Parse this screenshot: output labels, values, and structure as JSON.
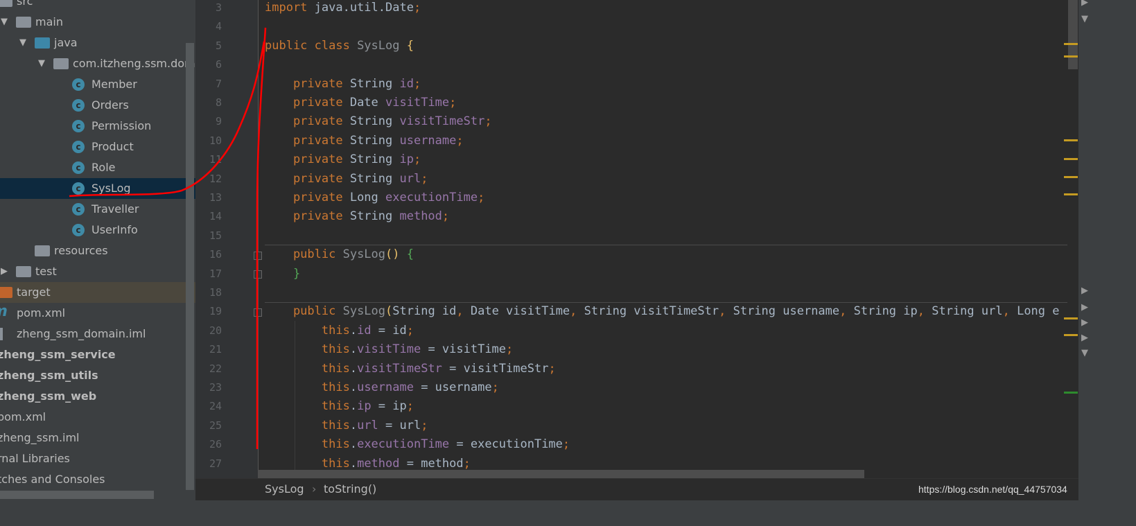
{
  "tree": [
    {
      "label": "src",
      "indent": 0,
      "icon": "folder",
      "color": "#8a9199"
    },
    {
      "label": "main",
      "indent": 1,
      "icon": "folder",
      "arrow": "down",
      "color": "#8a9199"
    },
    {
      "label": "java",
      "indent": 2,
      "icon": "folder",
      "arrow": "down",
      "color": "#3d87a8"
    },
    {
      "label": "com.itzheng.ssm.domain",
      "indent": 3,
      "icon": "package",
      "arrow": "down",
      "color": "#8a9199"
    },
    {
      "label": "Member",
      "indent": 4,
      "icon": "class"
    },
    {
      "label": "Orders",
      "indent": 4,
      "icon": "class"
    },
    {
      "label": "Permission",
      "indent": 4,
      "icon": "class"
    },
    {
      "label": "Product",
      "indent": 4,
      "icon": "class"
    },
    {
      "label": "Role",
      "indent": 4,
      "icon": "class"
    },
    {
      "label": "SysLog",
      "indent": 4,
      "icon": "class",
      "selected": true
    },
    {
      "label": "Traveller",
      "indent": 4,
      "icon": "class"
    },
    {
      "label": "UserInfo",
      "indent": 4,
      "icon": "class"
    },
    {
      "label": "resources",
      "indent": 2,
      "icon": "resources-folder",
      "color": "#8a9199"
    },
    {
      "label": "test",
      "indent": 1,
      "icon": "folder",
      "arrow": "right",
      "color": "#8a9199"
    },
    {
      "label": "target",
      "indent": 0,
      "icon": "folder",
      "color": "#c0642c",
      "highlight": true
    },
    {
      "label": "pom.xml",
      "indent": 0,
      "icon": "maven"
    },
    {
      "label": "zheng_ssm_domain.iml",
      "indent": 0,
      "icon": "iml-file"
    },
    {
      "label": "zheng_ssm_service",
      "indent": -1,
      "bold": true
    },
    {
      "label": "zheng_ssm_utils",
      "indent": -1,
      "bold": true
    },
    {
      "label": "zheng_ssm_web",
      "indent": -1,
      "bold": true
    },
    {
      "label": "pom.xml",
      "indent": -1
    },
    {
      "label": "zheng_ssm.iml",
      "indent": -1
    },
    {
      "label": "rnal Libraries",
      "indent": -1
    },
    {
      "label": "tches and Consoles",
      "indent": -1
    }
  ],
  "code": [
    {
      "n": "3",
      "t": [
        [
          "import ",
          "kw"
        ],
        [
          "java.util.Date",
          "nm"
        ],
        [
          ";",
          "kw"
        ]
      ]
    },
    {
      "n": "4",
      "t": []
    },
    {
      "n": "5",
      "t": [
        [
          "public class ",
          "kw"
        ],
        [
          "SysLog ",
          "gr"
        ],
        [
          "{",
          "br"
        ]
      ]
    },
    {
      "n": "6",
      "t": []
    },
    {
      "n": "7",
      "t": [
        [
          "    private ",
          "kw"
        ],
        [
          "String ",
          "nm"
        ],
        [
          "id",
          "fd"
        ],
        [
          ";",
          "kw"
        ]
      ]
    },
    {
      "n": "8",
      "t": [
        [
          "    private ",
          "kw"
        ],
        [
          "Date ",
          "nm"
        ],
        [
          "visitTime",
          "fd"
        ],
        [
          ";",
          "kw"
        ]
      ]
    },
    {
      "n": "9",
      "t": [
        [
          "    private ",
          "kw"
        ],
        [
          "String ",
          "nm"
        ],
        [
          "visitTimeStr",
          "fd"
        ],
        [
          ";",
          "kw"
        ]
      ]
    },
    {
      "n": "10",
      "t": [
        [
          "    private ",
          "kw"
        ],
        [
          "String ",
          "nm"
        ],
        [
          "username",
          "fd"
        ],
        [
          ";",
          "kw"
        ]
      ]
    },
    {
      "n": "11",
      "t": [
        [
          "    private ",
          "kw"
        ],
        [
          "String ",
          "nm"
        ],
        [
          "ip",
          "fd"
        ],
        [
          ";",
          "kw"
        ]
      ]
    },
    {
      "n": "12",
      "t": [
        [
          "    private ",
          "kw"
        ],
        [
          "String ",
          "nm"
        ],
        [
          "url",
          "fd"
        ],
        [
          ";",
          "kw"
        ]
      ]
    },
    {
      "n": "13",
      "t": [
        [
          "    private ",
          "kw"
        ],
        [
          "Long ",
          "nm"
        ],
        [
          "executionTime",
          "fd"
        ],
        [
          ";",
          "kw"
        ]
      ]
    },
    {
      "n": "14",
      "t": [
        [
          "    private ",
          "kw"
        ],
        [
          "String ",
          "nm"
        ],
        [
          "method",
          "fd"
        ],
        [
          ";",
          "kw"
        ]
      ]
    },
    {
      "n": "15",
      "t": []
    },
    {
      "n": "16",
      "t": [
        [
          "    public ",
          "kw"
        ],
        [
          "SysLog",
          "gr"
        ],
        [
          "() ",
          "br"
        ],
        [
          "{",
          "gn"
        ]
      ]
    },
    {
      "n": "17",
      "t": [
        [
          "    }",
          "gn"
        ]
      ]
    },
    {
      "n": "18",
      "t": []
    },
    {
      "n": "19",
      "t": [
        [
          "    public ",
          "kw"
        ],
        [
          "SysLog",
          "gr"
        ],
        [
          "(",
          "br"
        ],
        [
          "String id",
          "nm"
        ],
        [
          ", ",
          "kw"
        ],
        [
          "Date visitTime",
          "nm"
        ],
        [
          ", ",
          "kw"
        ],
        [
          "String visitTimeStr",
          "nm"
        ],
        [
          ", ",
          "kw"
        ],
        [
          "String username",
          "nm"
        ],
        [
          ", ",
          "kw"
        ],
        [
          "String ip",
          "nm"
        ],
        [
          ", ",
          "kw"
        ],
        [
          "String url",
          "nm"
        ],
        [
          ", ",
          "kw"
        ],
        [
          "Long e",
          "nm"
        ]
      ]
    },
    {
      "n": "20",
      "t": [
        [
          "        this",
          "kw"
        ],
        [
          ".",
          "nm"
        ],
        [
          "id",
          "fd"
        ],
        [
          " = id",
          "nm"
        ],
        [
          ";",
          "kw"
        ]
      ]
    },
    {
      "n": "21",
      "t": [
        [
          "        this",
          "kw"
        ],
        [
          ".",
          "nm"
        ],
        [
          "visitTime",
          "fd"
        ],
        [
          " = visitTime",
          "nm"
        ],
        [
          ";",
          "kw"
        ]
      ]
    },
    {
      "n": "22",
      "t": [
        [
          "        this",
          "kw"
        ],
        [
          ".",
          "nm"
        ],
        [
          "visitTimeStr",
          "fd"
        ],
        [
          " = visitTimeStr",
          "nm"
        ],
        [
          ";",
          "kw"
        ]
      ]
    },
    {
      "n": "23",
      "t": [
        [
          "        this",
          "kw"
        ],
        [
          ".",
          "nm"
        ],
        [
          "username",
          "fd"
        ],
        [
          " = username",
          "nm"
        ],
        [
          ";",
          "kw"
        ]
      ]
    },
    {
      "n": "24",
      "t": [
        [
          "        this",
          "kw"
        ],
        [
          ".",
          "nm"
        ],
        [
          "ip",
          "fd"
        ],
        [
          " = ip",
          "nm"
        ],
        [
          ";",
          "kw"
        ]
      ]
    },
    {
      "n": "25",
      "t": [
        [
          "        this",
          "kw"
        ],
        [
          ".",
          "nm"
        ],
        [
          "url",
          "fd"
        ],
        [
          " = url",
          "nm"
        ],
        [
          ";",
          "kw"
        ]
      ]
    },
    {
      "n": "26",
      "t": [
        [
          "        this",
          "kw"
        ],
        [
          ".",
          "nm"
        ],
        [
          "executionTime",
          "fd"
        ],
        [
          " = executionTime",
          "nm"
        ],
        [
          ";",
          "kw"
        ]
      ]
    },
    {
      "n": "27",
      "t": [
        [
          "        this",
          "kw"
        ],
        [
          ".",
          "nm"
        ],
        [
          "method",
          "fd"
        ],
        [
          " = method",
          "nm"
        ],
        [
          ";",
          "kw"
        ]
      ]
    }
  ],
  "breadcrumb": {
    "class": "SysLog",
    "separator": "›",
    "method": "toString()"
  },
  "watermark": "https://blog.csdn.net/qq_44757034",
  "colors": {
    "keyword": "#cc7832",
    "field": "#9876aa",
    "text": "#a9b7c6",
    "selection": "#0d293e",
    "annotation": "#ff0000",
    "warning_marker": "#c59b22",
    "ok_marker": "#2e8b2e"
  }
}
